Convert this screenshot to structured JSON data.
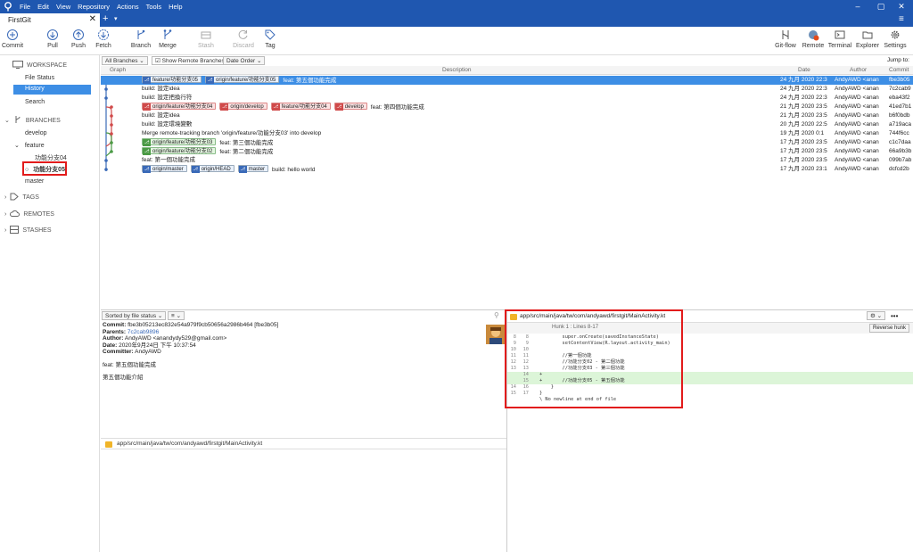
{
  "app": {
    "menu": [
      "File",
      "Edit",
      "View",
      "Repository",
      "Actions",
      "Tools",
      "Help"
    ],
    "window_controls": [
      "–",
      "▢",
      "✕"
    ]
  },
  "tabs": [
    {
      "label": "FirstGit",
      "close": "✕"
    }
  ],
  "tabbar": {
    "plus": "+",
    "caret": "▾",
    "menu": "≡"
  },
  "toolbar": {
    "left": [
      {
        "label": "Commit",
        "icon": "plus-circle-icon",
        "enabled": true
      },
      {
        "label": "Pull",
        "icon": "arrow-down-circle-icon",
        "enabled": true
      },
      {
        "label": "Push",
        "icon": "arrow-up-circle-icon",
        "enabled": true
      },
      {
        "label": "Fetch",
        "icon": "fetch-arrows-icon",
        "enabled": true
      },
      {
        "label": "Branch",
        "icon": "branch-icon",
        "enabled": true
      },
      {
        "label": "Merge",
        "icon": "merge-icon",
        "enabled": true
      },
      {
        "label": "Stash",
        "icon": "stash-icon",
        "enabled": false
      },
      {
        "label": "Discard",
        "icon": "discard-icon",
        "enabled": false
      },
      {
        "label": "Tag",
        "icon": "tag-icon",
        "enabled": true
      }
    ],
    "right": [
      {
        "label": "Git-flow",
        "icon": "gitflow-icon"
      },
      {
        "label": "Remote",
        "icon": "remote-globe-icon"
      },
      {
        "label": "Terminal",
        "icon": "terminal-icon"
      },
      {
        "label": "Explorer",
        "icon": "folder-icon"
      },
      {
        "label": "Settings",
        "icon": "gear-icon"
      }
    ]
  },
  "sidebar": {
    "workspace": {
      "title": "WORKSPACE",
      "items": [
        "File Status",
        "History",
        "Search"
      ],
      "selected": "History"
    },
    "branches": {
      "title": "BRANCHES",
      "items": [
        "develop",
        "feature",
        "功能分支04",
        "功能分支05",
        "master"
      ],
      "current": "功能分支05",
      "current_marker": "○"
    },
    "tags": {
      "title": "TAGS"
    },
    "remotes": {
      "title": "REMOTES"
    },
    "stashes": {
      "title": "STASHES"
    },
    "chevrons": {
      "open": "⌄",
      "closed": "›"
    }
  },
  "filters": {
    "branches": "All Branches",
    "show_remote": "Show Remote Branches",
    "show_remote_checked": true,
    "order": "Date Order",
    "jump": "Jump to:"
  },
  "columns": {
    "graph": "Graph",
    "description": "Description",
    "date": "Date",
    "author": "Author",
    "commit": "Commit"
  },
  "commits": [
    {
      "refs": [
        {
          "name": "feature/功能分支05",
          "kind": "cur"
        },
        {
          "name": "origin/feature/功能分支05",
          "kind": "blue"
        }
      ],
      "message": "feat: 第五個功能完成",
      "date": "24 九月 2020 22:3",
      "author": "AndyAWD <anan",
      "hash": "fbe3b05",
      "selected": true
    },
    {
      "refs": [],
      "message": "build: 設定idea",
      "date": "24 九月 2020 22:3",
      "author": "AndyAWD <anan",
      "hash": "7c2cab9"
    },
    {
      "refs": [],
      "message": "build: 設定把換行符",
      "date": "24 九月 2020 22:3",
      "author": "AndyAWD <anan",
      "hash": "eba43f2"
    },
    {
      "refs": [
        {
          "name": "origin/feature/功能分支04",
          "kind": "red"
        },
        {
          "name": "origin/develop",
          "kind": "red"
        },
        {
          "name": "feature/功能分支04",
          "kind": "red"
        },
        {
          "name": "develop",
          "kind": "red"
        }
      ],
      "message": "feat: 第四個功能完成",
      "date": "21 九月 2020 23:5",
      "author": "AndyAWD <anan",
      "hash": "41ed7b1"
    },
    {
      "refs": [],
      "message": "build: 設定idea",
      "date": "21 九月 2020 23:5",
      "author": "AndyAWD <anan",
      "hash": "b6f0bdb"
    },
    {
      "refs": [],
      "message": "build: 設定環境變數",
      "date": "20 九月 2020 22:5",
      "author": "AndyAWD <anan",
      "hash": "a719aca"
    },
    {
      "refs": [],
      "message": "Merge remote-tracking branch 'origin/feature/功能分支03' into develop",
      "date": "19 九月 2020 0:1",
      "author": "AndyAWD <anan",
      "hash": "744f6cc"
    },
    {
      "refs": [
        {
          "name": "origin/feature/功能分支03",
          "kind": "green"
        }
      ],
      "message": "feat: 第三個功能完成",
      "date": "17 九月 2020 23:5",
      "author": "AndyAWD <anan",
      "hash": "c1c7daa"
    },
    {
      "refs": [
        {
          "name": "origin/feature/功能分支02",
          "kind": "green"
        }
      ],
      "message": "feat: 第二個功能完成",
      "date": "17 九月 2020 23:5",
      "author": "AndyAWD <anan",
      "hash": "66a9b3b"
    },
    {
      "refs": [],
      "message": "feat: 第一個功能完成",
      "date": "17 九月 2020 23:5",
      "author": "AndyAWD <anan",
      "hash": "099b7ab"
    },
    {
      "refs": [
        {
          "name": "origin/master",
          "kind": "blue"
        },
        {
          "name": "origin/HEAD",
          "kind": "blue"
        },
        {
          "name": "master",
          "kind": "blue"
        }
      ],
      "message": "build: hello world",
      "date": "17 九月 2020 23:1",
      "author": "AndyAWD <anan",
      "hash": "dcfcd2b"
    }
  ],
  "details": {
    "sort_label": "Sorted by file status",
    "commit_label": "Commit:",
    "commit_value": "fbe3b05213ec832e54a979f9cb50656a2986b464 [fbe3b05]",
    "parents_label": "Parents:",
    "parents_value": "7c2cab9896",
    "author_label": "Author:",
    "author_value": "AndyAWD <anandydy529@gmail.com>",
    "date_label": "Date:",
    "date_value": "2020年9月24日 下午 10:37:54",
    "committer_label": "Committer:",
    "committer_value": "AndyAWD",
    "message_1": "feat: 第五個功能完成",
    "message_2": "第五個功能介紹"
  },
  "changed_file": "app/src/main/java/tw/com/andyawd/firstgit/MainActivity.kt",
  "diff": {
    "file": "app/src/main/java/tw/com/andyawd/firstgit/MainActivity.kt",
    "hunk": "Hunk 1 : Lines 8-17",
    "reverse_label": "Reverse hunk",
    "more": "•••",
    "lines": [
      {
        "old": "8",
        "new": "8",
        "text": "        super.onCreate(savedInstanceState)",
        "type": "ctx"
      },
      {
        "old": "9",
        "new": "9",
        "text": "        setContentView(R.layout.activity_main)",
        "type": "ctx"
      },
      {
        "old": "10",
        "new": "10",
        "text": "",
        "type": "ctx"
      },
      {
        "old": "11",
        "new": "11",
        "text": "        //第一個功能",
        "type": "ctx"
      },
      {
        "old": "12",
        "new": "12",
        "text": "        //功能分支02 - 第二個功能",
        "type": "ctx"
      },
      {
        "old": "13",
        "new": "13",
        "text": "        //功能分支03 - 第三個功能",
        "type": "ctx"
      },
      {
        "old": "",
        "new": "14",
        "text": "+",
        "type": "add"
      },
      {
        "old": "",
        "new": "15",
        "text": "+       //功能分支05 - 第五個功能",
        "type": "add"
      },
      {
        "old": "14",
        "new": "16",
        "text": "    }",
        "type": "ctx"
      },
      {
        "old": "15",
        "new": "17",
        "text": "}",
        "type": "ctx"
      },
      {
        "old": "",
        "new": "",
        "text": "\\ No newline at end of file",
        "type": "ctx"
      }
    ]
  },
  "colors": {
    "accent": "#1f57b0",
    "selection": "#3d8ee5",
    "highlight_box": "#e21b1b",
    "added_line": "#dcf5d8"
  }
}
